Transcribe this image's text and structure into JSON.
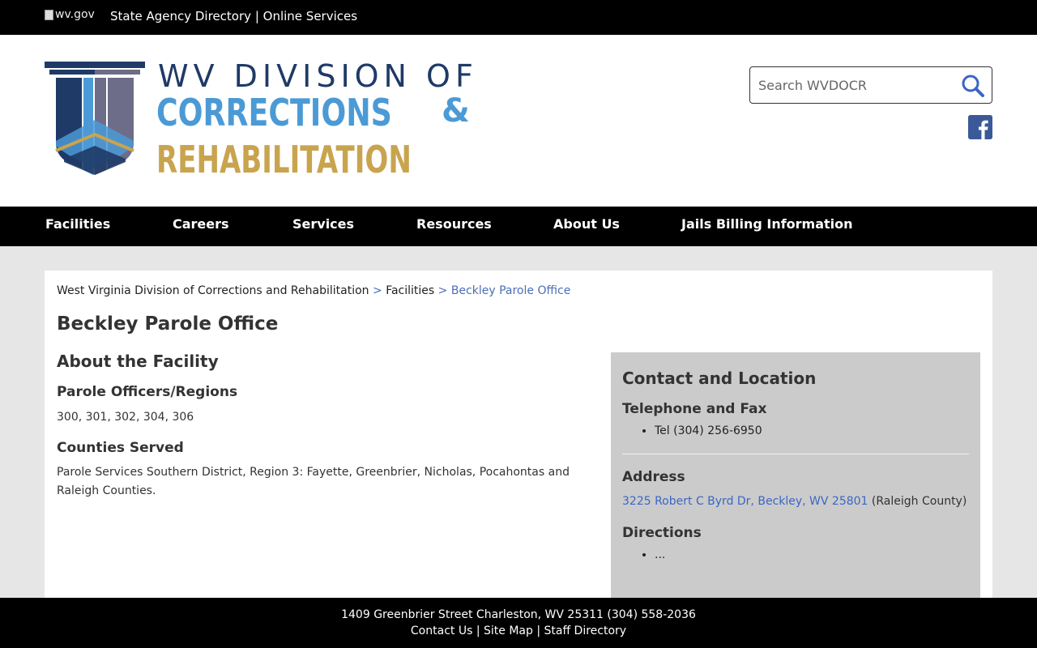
{
  "topbar": {
    "wvgov_alt": "wv.gov",
    "links_text": "State Agency Directory | Online Services",
    "link1": "State Agency Directory",
    "link_sep": "|",
    "link2": "Online Services"
  },
  "logo": {
    "line1": "WV DIVISION OF",
    "line2": "CORRECTIONS",
    "amp": "&",
    "line3": "REHABILITATION",
    "colors": {
      "navy": "#1f3a66",
      "blue": "#4b9ad6",
      "gold": "#c9a44e",
      "gray": "#6d6d89"
    }
  },
  "search": {
    "placeholder": "Search WVDOCR",
    "icon": "search-icon"
  },
  "social": {
    "icon": "facebook-icon"
  },
  "nav": [
    "Facilities",
    "Careers",
    "Services",
    "Resources",
    "About Us",
    "Jails Billing Information"
  ],
  "breadcrumb": {
    "home": "West Virginia Division of Corrections and Rehabilitation",
    "sep": ">",
    "facilities": "Facilities",
    "current": "Beckley Parole Office"
  },
  "page": {
    "title": "Beckley Parole Office",
    "about_heading": "About the Facility",
    "officers_heading": "Parole Officers/Regions",
    "officers_value": "300, 301, 302, 304, 306",
    "counties_heading": "Counties Served",
    "counties_value": "Parole Services Southern District, Region 3: Fayette, Greenbrier, Nicholas, Pocahontas and Raleigh Counties."
  },
  "sidebar": {
    "heading": "Contact and Location",
    "phone_heading": "Telephone and Fax",
    "phone": "Tel (304) 256-6950",
    "address_heading": "Address",
    "address_link": "3225 Robert C Byrd Dr, Beckley, WV 25801",
    "address_county": " (Raleigh County)",
    "directions_heading": "Directions",
    "directions_item": "..."
  },
  "footer": {
    "address": "1409 Greenbrier Street Charleston, WV 25311 (304) 558-2036",
    "contact": "Contact Us",
    "sep": "|",
    "sitemap": "Site Map",
    "staff": "Staff Directory"
  }
}
